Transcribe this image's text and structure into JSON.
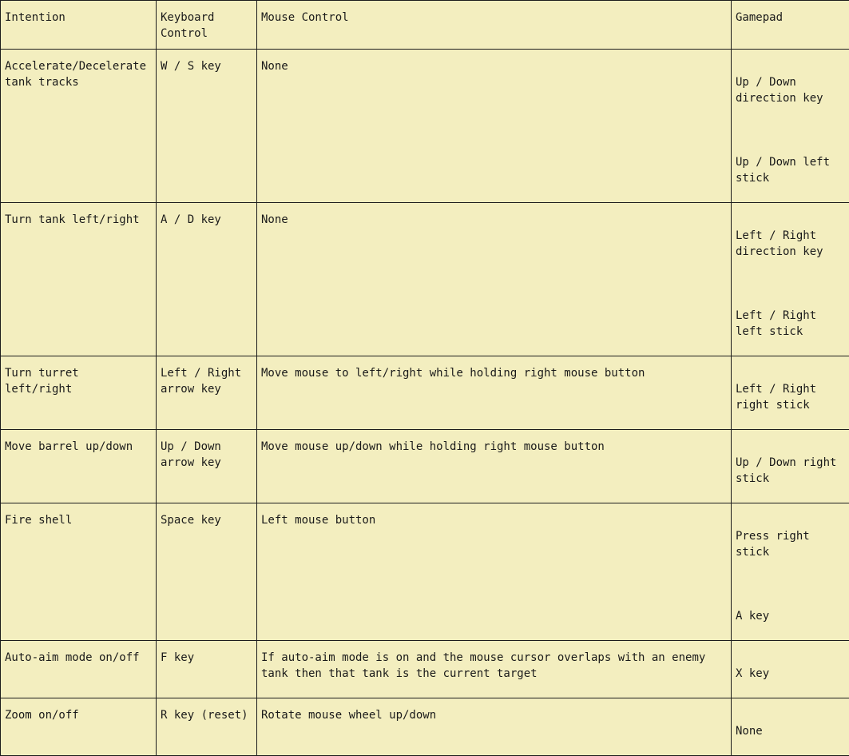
{
  "table": {
    "headers": [
      "Intention",
      "Keyboard\nControl",
      "Mouse Control",
      "Gamepad"
    ],
    "rows": [
      {
        "intention": "Accelerate/Decelerate tank tracks",
        "keyboard": "W / S key",
        "mouse": "None",
        "gamepad": [
          "Up / Down direction key",
          "Up / Down left stick"
        ]
      },
      {
        "intention": "Turn tank left/right",
        "keyboard": "A / D key",
        "mouse": "None",
        "gamepad": [
          "Left / Right direction key",
          "Left / Right left stick"
        ]
      },
      {
        "intention": "Turn turret left/right",
        "keyboard": "Left / Right arrow key",
        "mouse": "Move mouse to left/right while holding right mouse button",
        "gamepad": [
          "Left / Right right stick"
        ]
      },
      {
        "intention": "Move barrel up/down",
        "keyboard": "Up / Down arrow key",
        "mouse": "Move mouse up/down while holding right mouse button",
        "gamepad": [
          "Up / Down right stick"
        ]
      },
      {
        "intention": "Fire shell",
        "keyboard": "Space key",
        "mouse": "Left mouse button",
        "gamepad": [
          "Press right stick",
          "A key"
        ]
      },
      {
        "intention": "Auto-aim mode on/off",
        "keyboard": "F key",
        "mouse": "If auto-aim mode is on and the mouse cursor overlaps with an enemy tank then that tank is the current target",
        "gamepad": [
          "X key"
        ]
      },
      {
        "intention": "Zoom on/off",
        "keyboard": "R key (reset)",
        "mouse": "Rotate mouse wheel up/down",
        "gamepad": [
          "None"
        ]
      }
    ]
  }
}
